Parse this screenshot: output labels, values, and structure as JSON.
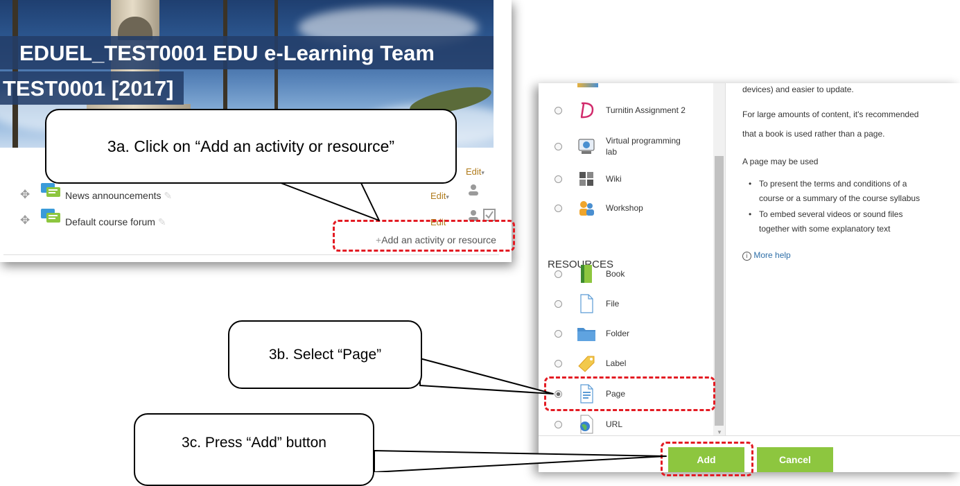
{
  "course": {
    "title_line1": "EDUEL_TEST0001 EDU e-Learning Team",
    "title_line2": "TEST0001 [2017]",
    "edit_label": "Edit",
    "items": [
      {
        "label": "News announcements"
      },
      {
        "label": "Default course forum"
      }
    ],
    "add_activity_label": "Add an activity or resource"
  },
  "dialog": {
    "activities": [
      {
        "label": "Turnitin Assignment 2",
        "icon": "turnitin-icon"
      },
      {
        "label": "Virtual programming lab",
        "icon": "vpl-icon"
      },
      {
        "label": "Wiki",
        "icon": "wiki-icon"
      },
      {
        "label": "Workshop",
        "icon": "workshop-icon"
      }
    ],
    "resources_heading": "RESOURCES",
    "resources": [
      {
        "label": "Book",
        "icon": "book-icon"
      },
      {
        "label": "File",
        "icon": "file-icon"
      },
      {
        "label": "Folder",
        "icon": "folder-icon"
      },
      {
        "label": "Label",
        "icon": "label-icon"
      },
      {
        "label": "Page",
        "icon": "page-icon",
        "selected": true
      },
      {
        "label": "URL",
        "icon": "url-icon"
      }
    ],
    "help": {
      "top_fragment": "devices) and easier to update.",
      "para1_line1": "For large amounts of content, it's recommended",
      "para1_line2": "that a book is used rather than a page.",
      "para2": "A page may be used",
      "bullet1_line1": "To present the terms and conditions of a",
      "bullet1_line2": "course or a summary of the course syllabus",
      "bullet2_line1": "To embed several videos or sound files",
      "bullet2_line2": "together with some explanatory text",
      "more_help": "More help"
    },
    "add_button": "Add",
    "cancel_button": "Cancel"
  },
  "callouts": {
    "step_a": "3a. Click on “Add an activity or resource”",
    "step_b": "3b. Select “Page”",
    "step_c": "3c. Press “Add” button"
  },
  "colors": {
    "accent_green": "#8dc63f",
    "highlight_red": "#e31b23",
    "edit_link": "#b07b1c"
  }
}
